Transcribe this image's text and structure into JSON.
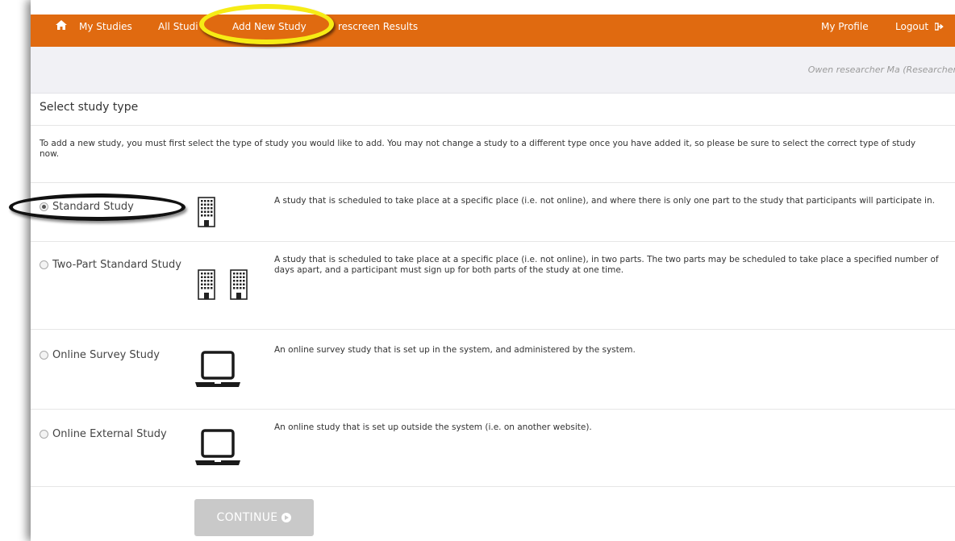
{
  "nav": {
    "home_icon": "home-icon",
    "items": [
      "My Studies",
      "All Studi",
      "Add New Study",
      "rescreen Results"
    ],
    "right_items": [
      "My Profile",
      "Logout"
    ],
    "logout_icon": "sign-out-icon"
  },
  "user": {
    "name": "Owen researcher Ma (Researcher"
  },
  "page_title": "Select study type",
  "intro": "To add a new study, you must first select the type of study you would like to add. You may not change a study to a different type once you have added it, so please be sure to select the correct type of study now.",
  "options": [
    {
      "label": "Standard Study",
      "selected": true,
      "icon": "building-icon",
      "description": "A study that is scheduled to take place at a specific place (i.e. not online), and where there is only one part to the study that participants will participate in."
    },
    {
      "label": "Two-Part Standard Study",
      "selected": false,
      "icon": "two-buildings-icon",
      "description": "A study that is scheduled to take place at a specific place (i.e. not online), in two parts. The two parts may be scheduled to take place a specified number of days apart, and a participant must sign up for both parts of the study at one time."
    },
    {
      "label": "Online Survey Study",
      "selected": false,
      "icon": "laptop-icon",
      "description": "An online survey study that is set up in the system, and administered by the system."
    },
    {
      "label": "Online External Study",
      "selected": false,
      "icon": "laptop-icon",
      "description": "An online study that is set up outside the system (i.e. on another website)."
    }
  ],
  "continue_label": "CONTINUE",
  "colors": {
    "nav_bg": "#e06a10",
    "info_bar_bg": "#f1f1f5",
    "button_disabled": "#c9c9c9",
    "highlight_yellow": "#f6ec15",
    "highlight_black": "#111111"
  }
}
